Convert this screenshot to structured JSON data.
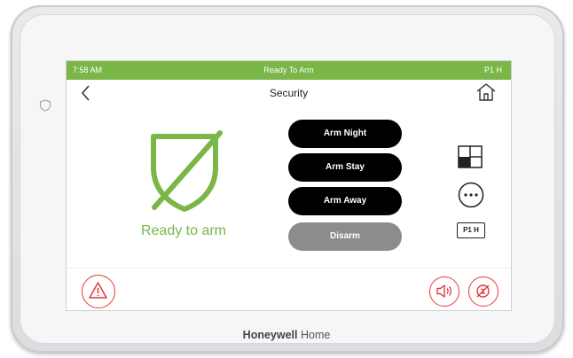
{
  "status_bar": {
    "time": "7:58 AM",
    "status": "Ready To Arm",
    "partition": "P1 H",
    "color": "#7ab648"
  },
  "header": {
    "title": "Security",
    "back_icon": "chevron-left-icon",
    "home_icon": "home-icon"
  },
  "main": {
    "state_label": "Ready to arm",
    "state_icon": "shield-slash-icon",
    "state_color": "#7ab648",
    "buttons": {
      "arm_night": "Arm Night",
      "arm_stay": "Arm Stay",
      "arm_away": "Arm Away",
      "disarm": "Disarm"
    }
  },
  "side_controls": {
    "zones_icon": "zones-grid-icon",
    "more_icon": "more-dots-icon",
    "partition_badge": "P1 H"
  },
  "footer": {
    "panic_icon": "warning-triangle-icon",
    "volume_icon": "speaker-icon",
    "mute_icon": "chime-off-icon",
    "accent": "#e53935"
  },
  "device": {
    "brand_bold": "Honeywell",
    "brand_light": "Home"
  }
}
